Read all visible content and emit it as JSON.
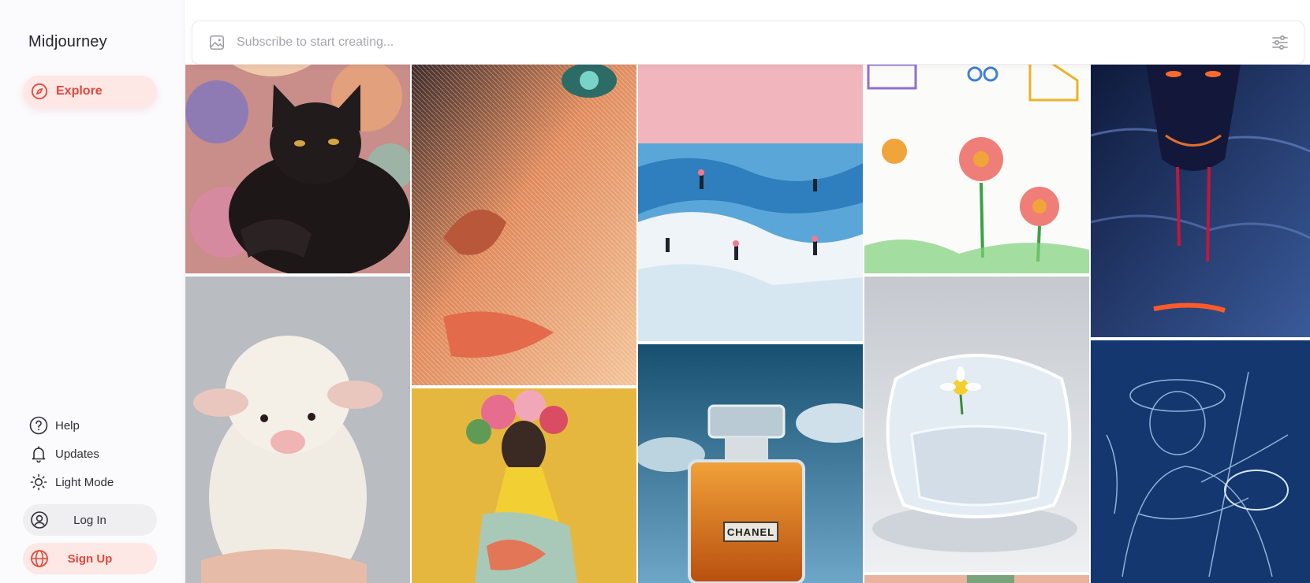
{
  "sidebar": {
    "brand": "Midjourney",
    "explore_label": "Explore",
    "help_label": "Help",
    "updates_label": "Updates",
    "light_mode_label": "Light Mode",
    "login_label": "Log In",
    "signup_label": "Sign Up"
  },
  "search": {
    "placeholder": "Subscribe to start creating..."
  },
  "gallery": {
    "perfume_label": "CHANEL"
  },
  "colors": {
    "accent": "#e2483b",
    "accent_bg": "#fde8e5",
    "sidebar_bg": "#fbfafd"
  },
  "icons": {
    "explore": "compass-icon",
    "help": "question-circle-icon",
    "updates": "bell-icon",
    "light_mode": "sun-icon",
    "login": "user-circle-icon",
    "signup": "globe-icon",
    "search": "image-icon",
    "filter": "sliders-icon"
  }
}
